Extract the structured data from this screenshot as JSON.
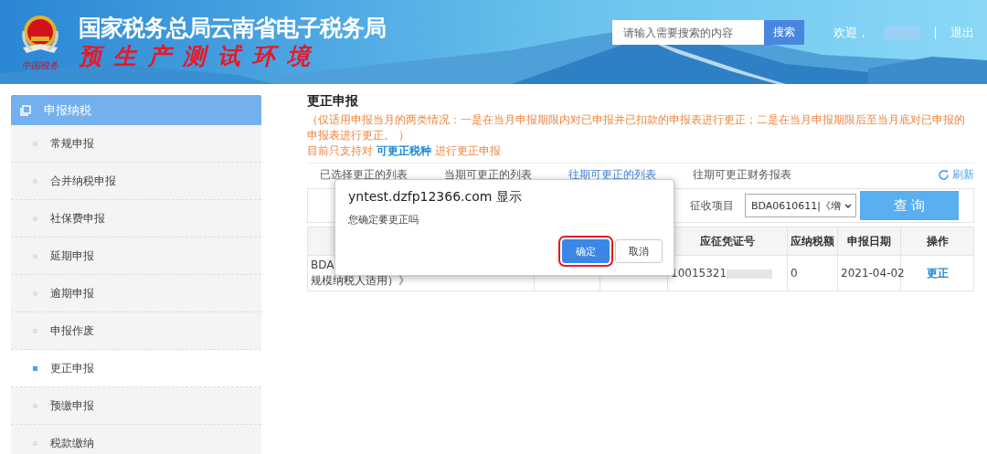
{
  "header": {
    "title": "国家税务总局云南省电子税务局",
    "subtitle": "预生产测试环境",
    "logo_text": "中国税务",
    "search": {
      "placeholder": "请输入需要搜索的内容",
      "button": "搜索"
    },
    "welcome": "欢迎，",
    "logout": "退出"
  },
  "sidebar": {
    "title": "申报纳税",
    "items": [
      {
        "label": "常规申报",
        "selected": false
      },
      {
        "label": "合并纳税申报",
        "selected": false
      },
      {
        "label": "社保费申报",
        "selected": false
      },
      {
        "label": "延期申报",
        "selected": false
      },
      {
        "label": "逾期申报",
        "selected": false
      },
      {
        "label": "申报作废",
        "selected": false
      },
      {
        "label": "更正申报",
        "selected": true
      },
      {
        "label": "预缴申报",
        "selected": false
      },
      {
        "label": "税款缴纳",
        "selected": false
      }
    ]
  },
  "main": {
    "title": "更正申报",
    "note": "（仅适用申报当月的两类情况：一是在当月申报期限内对已申报并已扣款的申报表进行更正；二是在当月申报期限后至当月底对已申报的申报表进行更正。 ）",
    "support": "目前只支持对 **可更正税种** 进行更正申报",
    "tabs": [
      {
        "label": "已选择更正的列表",
        "selected": false
      },
      {
        "label": "当期可更正的列表",
        "selected": false
      },
      {
        "label": "往期可更正的列表",
        "selected": true
      },
      {
        "label": "往期可更正财务报表",
        "selected": false
      }
    ],
    "refresh": "刷新",
    "filter": {
      "label": "征收项目",
      "value": "BDA0610611|《增",
      "button": "查 询"
    },
    "table": {
      "columns": [
        "应征凭证号",
        "应纳税额",
        "申报日期",
        "操作"
      ],
      "rows": [
        {
          "item": [
            "BDA",
            "规模纳税人适用）》"
          ],
          "voucher": "10015321",
          "tax": "0",
          "date": "2021-04-02",
          "action": "更正"
        }
      ]
    }
  },
  "dialog": {
    "title": "yntest.dzfp12366.com 显示",
    "message": "您确定要更正吗",
    "buttons": [
      {
        "label": "确定",
        "selected": true
      },
      {
        "label": "取消",
        "selected": false
      }
    ]
  }
}
